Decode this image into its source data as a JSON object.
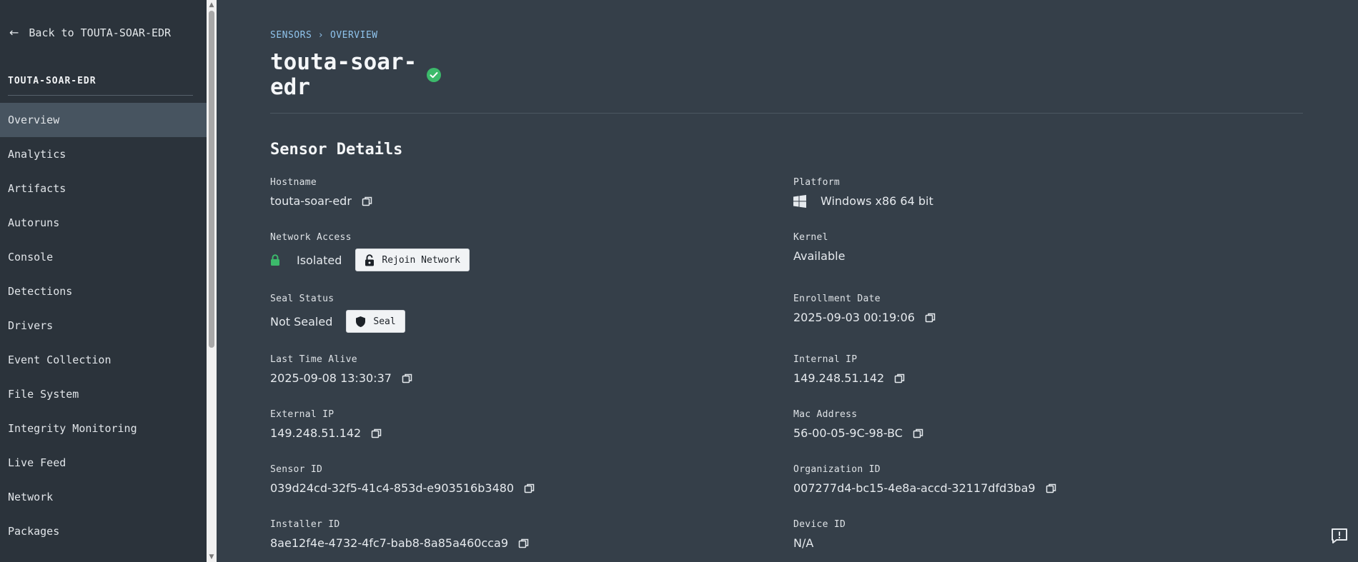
{
  "sidebar": {
    "back_label": "Back to TOUTA-SOAR-EDR",
    "org_title": "TOUTA-SOAR-EDR",
    "items": [
      {
        "label": "Overview",
        "active": true
      },
      {
        "label": "Analytics"
      },
      {
        "label": "Artifacts"
      },
      {
        "label": "Autoruns"
      },
      {
        "label": "Console"
      },
      {
        "label": "Detections"
      },
      {
        "label": "Drivers"
      },
      {
        "label": "Event Collection"
      },
      {
        "label": "File System"
      },
      {
        "label": "Integrity Monitoring"
      },
      {
        "label": "Live Feed"
      },
      {
        "label": "Network"
      },
      {
        "label": "Packages"
      }
    ]
  },
  "breadcrumb": [
    "SENSORS",
    "OVERVIEW"
  ],
  "sensor": {
    "title": "touta-soar-edr",
    "status_color": "#3cba6b"
  },
  "details": {
    "section_title": "Sensor Details",
    "hostname": {
      "label": "Hostname",
      "value": "touta-soar-edr"
    },
    "platform": {
      "label": "Platform",
      "value": "Windows x86 64 bit",
      "icon": "windows-icon"
    },
    "network_access": {
      "label": "Network Access",
      "value": "Isolated",
      "button": "Rejoin Network"
    },
    "kernel": {
      "label": "Kernel",
      "value": "Available"
    },
    "seal_status": {
      "label": "Seal Status",
      "value": "Not Sealed",
      "button": "Seal"
    },
    "enrollment_date": {
      "label": "Enrollment Date",
      "value": "2025-09-03 00:19:06"
    },
    "last_time_alive": {
      "label": "Last Time Alive",
      "value": "2025-09-08 13:30:37"
    },
    "internal_ip": {
      "label": "Internal IP",
      "value": "149.248.51.142"
    },
    "external_ip": {
      "label": "External IP",
      "value": "149.248.51.142"
    },
    "mac_address": {
      "label": "Mac Address",
      "value": "56-00-05-9C-98-BC"
    },
    "sensor_id": {
      "label": "Sensor ID",
      "value": "039d24cd-32f5-41c4-853d-e903516b3480"
    },
    "organization_id": {
      "label": "Organization ID",
      "value": "007277d4-bc15-4e8a-accd-32117dfd3ba9"
    },
    "installer_id": {
      "label": "Installer ID",
      "value": "8ae12f4e-4732-4fc7-bab8-8a85a460cca9"
    },
    "device_id": {
      "label": "Device ID",
      "value": "N/A"
    }
  },
  "colors": {
    "sidebar_bg": "#2b333b",
    "main_bg": "#353f49",
    "active_item_bg": "#475460",
    "breadcrumb": "#8fc3ec",
    "success": "#3cba6b"
  }
}
